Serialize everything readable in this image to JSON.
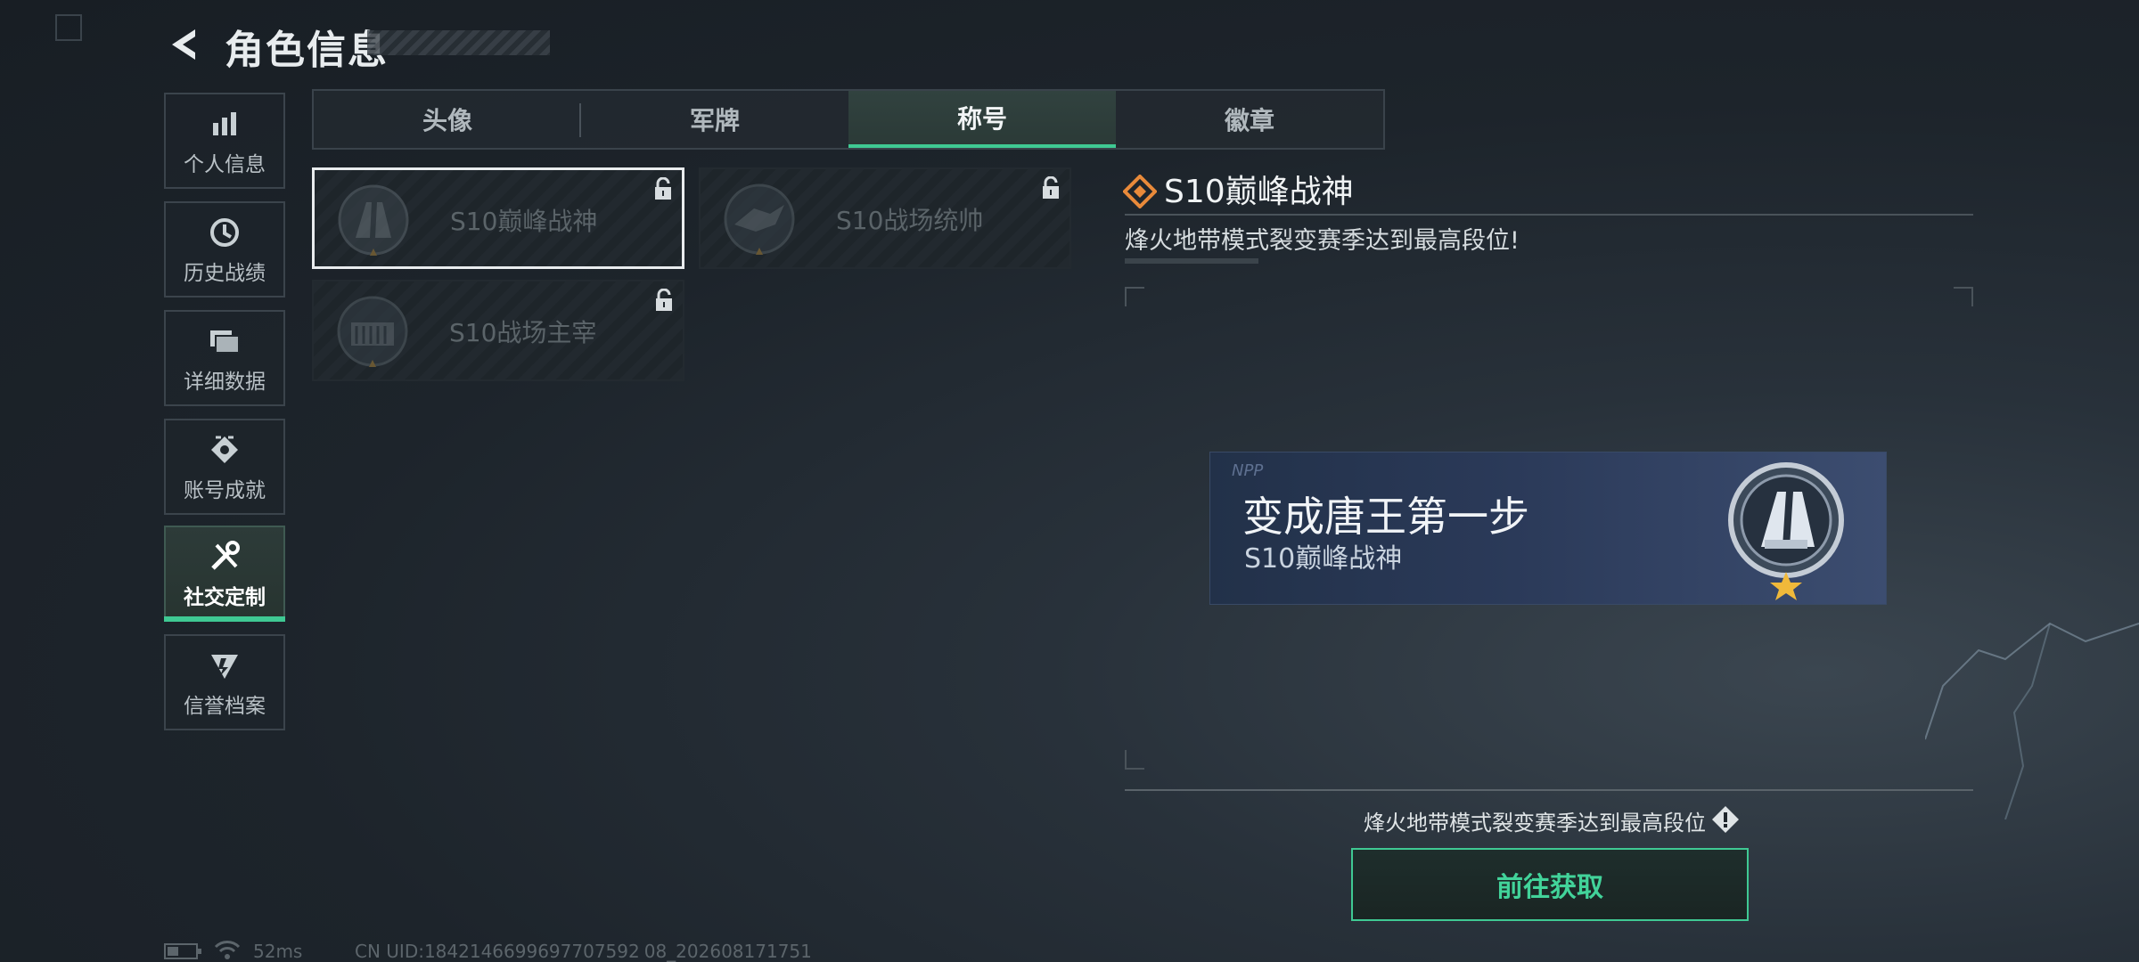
{
  "header": {
    "title": "角色信息"
  },
  "sidebar": {
    "items": [
      {
        "label": "个人信息",
        "icon": "bar-chart-icon"
      },
      {
        "label": "历史战绩",
        "icon": "clock-icon"
      },
      {
        "label": "详细数据",
        "icon": "folder-icon"
      },
      {
        "label": "账号成就",
        "icon": "achievement-icon"
      },
      {
        "label": "社交定制",
        "icon": "tools-icon",
        "active": true
      },
      {
        "label": "信誉档案",
        "icon": "reputation-icon"
      }
    ]
  },
  "tabs": [
    {
      "label": "头像"
    },
    {
      "label": "军牌"
    },
    {
      "label": "称号",
      "active": true
    },
    {
      "label": "徽章"
    }
  ],
  "titles": [
    {
      "name": "S10巅峰战神",
      "locked": true,
      "selected": true
    },
    {
      "name": "S10战场统帅",
      "locked": true
    },
    {
      "name": "S10战场主宰",
      "locked": true
    }
  ],
  "detail": {
    "title": "S10巅峰战神",
    "description": "烽火地带模式裂变赛季达到最高段位!",
    "banner": {
      "tag": "NPP",
      "main": "变成唐王第一步",
      "sub": "S10巅峰战神"
    },
    "requirement": "烽火地带模式裂变赛季达到最高段位",
    "button": "前往获取"
  },
  "status": {
    "ping": "52ms",
    "uid": "CN UID:1842146699697707592 08_202608171751"
  },
  "colors": {
    "accent": "#3fc993",
    "detail_icon": "#e98a3a"
  }
}
